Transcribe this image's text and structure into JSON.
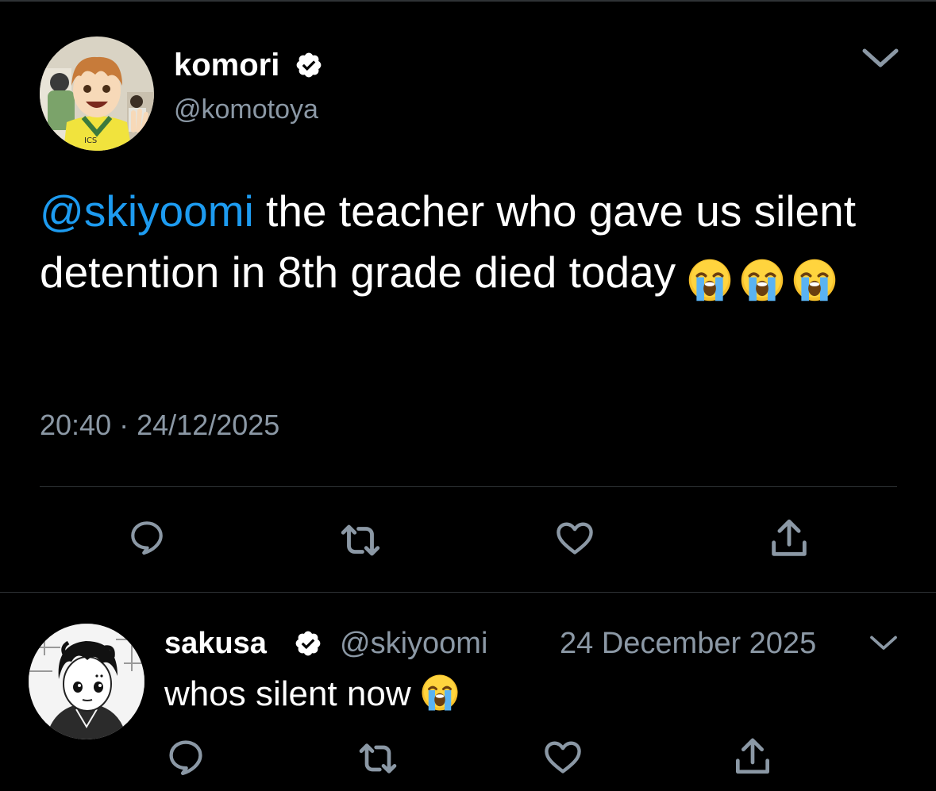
{
  "colors": {
    "background": "#000000",
    "text": "#ffffff",
    "secondary": "#8b98a5",
    "link": "#1d9bf0",
    "divider": "#2f3336",
    "verified_badge": "#ffffff"
  },
  "main_tweet": {
    "display_name": "komori",
    "handle": "@komotoya",
    "verified": true,
    "avatar": "avatar-illustration",
    "body": {
      "mention": "@skiyoomi",
      "text": " the teacher who gave us silent detention in 8th grade died today ",
      "emojis": [
        "😭",
        "😭",
        "😭"
      ]
    },
    "time": "20:40",
    "separator": "·",
    "date": "24/12/2025",
    "actions": [
      "reply-icon",
      "retweet-icon",
      "like-icon",
      "share-icon"
    ]
  },
  "reply_tweet": {
    "display_name": "sakusa",
    "handle": "@skiyoomi",
    "verified": true,
    "avatar": "avatar-illustration",
    "date": "24 December 2025",
    "body": {
      "text": "whos silent now ",
      "emojis": [
        "😭"
      ]
    },
    "actions": [
      "reply-icon",
      "retweet-icon",
      "like-icon",
      "share-icon"
    ]
  }
}
